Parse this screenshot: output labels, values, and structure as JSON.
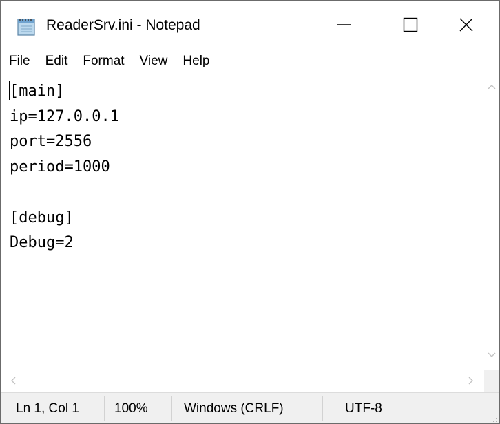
{
  "window": {
    "title": "ReaderSrv.ini - Notepad",
    "app_icon": "notepad-icon",
    "controls": [
      "minimize-icon",
      "maximize-icon",
      "close-icon"
    ]
  },
  "menu": {
    "items": [
      "File",
      "Edit",
      "Format",
      "View",
      "Help"
    ]
  },
  "editor": {
    "content": "[main]\nip=127.0.0.1\nport=2556\nperiod=1000\n\n[debug]\nDebug=2"
  },
  "status": {
    "position": "Ln 1, Col 1",
    "zoom": "100%",
    "line_ending": "Windows (CRLF)",
    "encoding": "UTF-8"
  },
  "colors": {
    "statusbar_bg": "#f0f0f0",
    "text": "#000000",
    "scroll_arrow": "#c2c2c2"
  }
}
